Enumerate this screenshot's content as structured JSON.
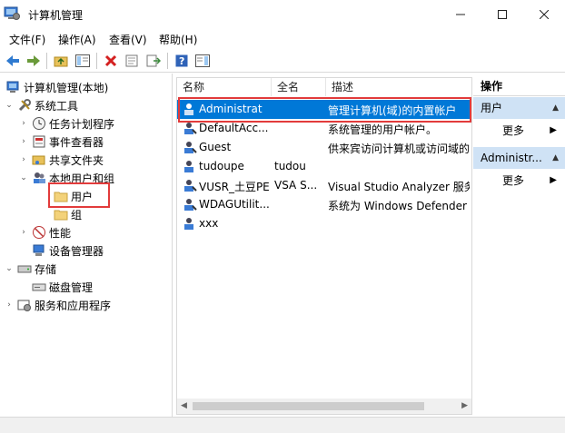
{
  "window": {
    "title": "计算机管理"
  },
  "menu": [
    "文件(F)",
    "操作(A)",
    "查看(V)",
    "帮助(H)"
  ],
  "tree": {
    "root": "计算机管理(本地)",
    "system_tools": "系统工具",
    "task_scheduler": "任务计划程序",
    "event_viewer": "事件查看器",
    "shared_folders": "共享文件夹",
    "local_users_groups": "本地用户和组",
    "users": "用户",
    "groups": "组",
    "performance": "性能",
    "device_manager": "设备管理器",
    "storage": "存储",
    "disk_management": "磁盘管理",
    "services_apps": "服务和应用程序"
  },
  "list": {
    "headers": [
      "名称",
      "全名",
      "描述"
    ],
    "rows": [
      {
        "name": "Administrat",
        "fullname": "",
        "desc": "管理计算机(域)的内置帐户"
      },
      {
        "name": "DefaultAcc...",
        "fullname": "",
        "desc": "系统管理的用户帐户。"
      },
      {
        "name": "Guest",
        "fullname": "",
        "desc": "供来宾访问计算机或访问域的"
      },
      {
        "name": "tudoupe",
        "fullname": "tudou",
        "desc": ""
      },
      {
        "name": "VUSR_土豆PE",
        "fullname": "VSA S...",
        "desc": "Visual Studio Analyzer 服务"
      },
      {
        "name": "WDAGUtilit...",
        "fullname": "",
        "desc": "系统为 Windows Defender ."
      },
      {
        "name": "xxx",
        "fullname": "",
        "desc": ""
      }
    ]
  },
  "actions": {
    "header": "操作",
    "section1": "用户",
    "more1": "更多",
    "section2": "Administr...",
    "more2": "更多"
  },
  "colors": {
    "selection": "#0078d7",
    "highlight": "#e23b3b",
    "action_section": "#cfe2f5"
  }
}
